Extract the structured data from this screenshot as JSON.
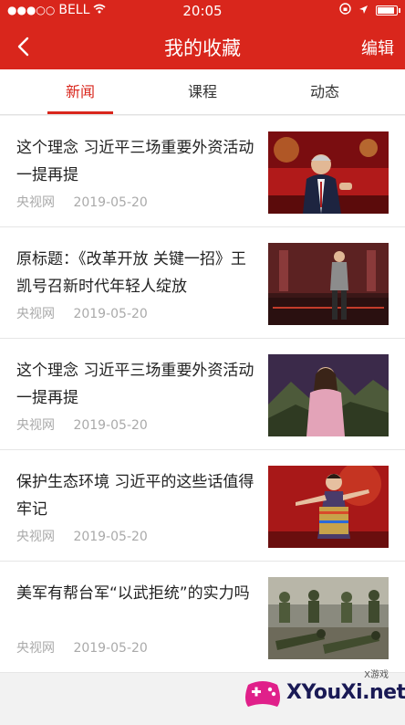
{
  "status_bar": {
    "carrier": "BELL",
    "time": "20:05"
  },
  "header": {
    "title": "我的收藏",
    "edit_label": "编辑"
  },
  "tabs": [
    {
      "label": "新闻",
      "active": true
    },
    {
      "label": "课程",
      "active": false
    },
    {
      "label": "动态",
      "active": false
    }
  ],
  "items": [
    {
      "title": "这个理念 习近平三场重要外资活动一提再提",
      "source": "央视网",
      "date": "2019-05-20",
      "thumb": "man-in-suit"
    },
    {
      "title": "原标题：《改革开放 关键一招》王凯号召新时代年轻人绽放",
      "source": "央视网",
      "date": "2019-05-20",
      "thumb": "man-on-stage"
    },
    {
      "title": "这个理念 习近平三场重要外资活动一提再提",
      "source": "央视网",
      "date": "2019-05-20",
      "thumb": "woman-mountains"
    },
    {
      "title": "保护生态环境 习近平的这些话值得牢记",
      "source": "央视网",
      "date": "2019-05-20",
      "thumb": "dancer-red-stage"
    },
    {
      "title": "美军有帮台军“以武拒统”的实力吗",
      "source": "央视网",
      "date": "2019-05-20",
      "thumb": "soldiers-training"
    }
  ],
  "watermark": {
    "brand": "XYouXi.net",
    "small": "X游戏"
  },
  "colors": {
    "accent": "#d9261c",
    "background": "#f2f2f2"
  }
}
